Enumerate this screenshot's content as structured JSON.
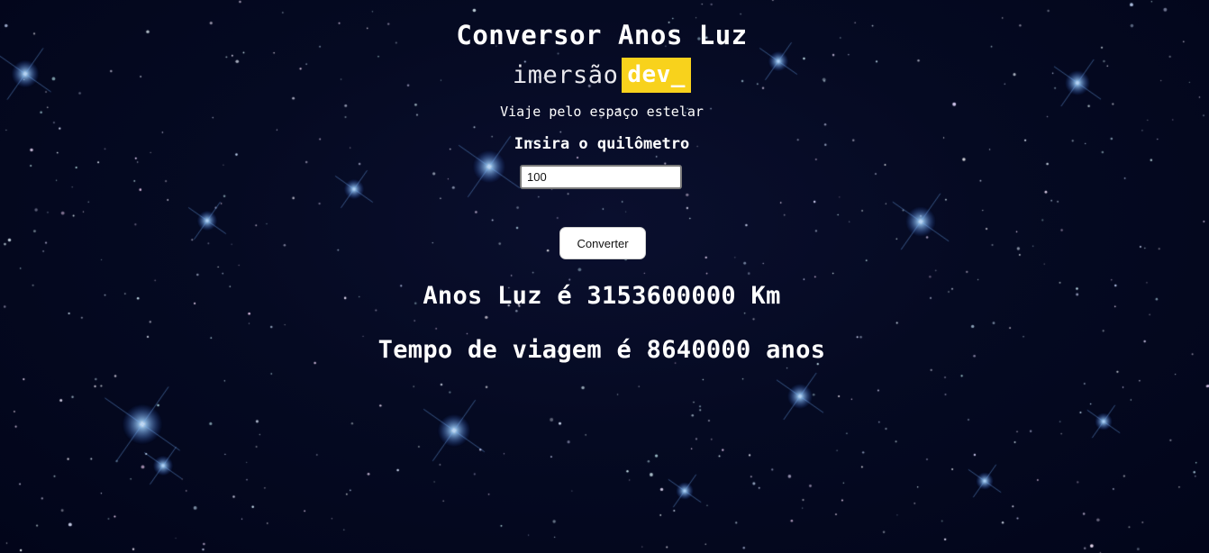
{
  "page": {
    "title": "Conversor Anos Luz",
    "brand": {
      "light_text": "imersão",
      "highlight_text": "dev_"
    },
    "subtitle": "Viaje pelo espaço estelar",
    "input_label": "Insira o quilômetro",
    "input_value": "100",
    "button_label": "Converter",
    "result_lightyears": "Anos Luz é 3153600000 Km",
    "result_travel_time": "Tempo de viagem é 8640000 anos"
  },
  "colors": {
    "background": "#050a22",
    "text": "#ffffff",
    "brand_highlight": "#f8d21c"
  }
}
